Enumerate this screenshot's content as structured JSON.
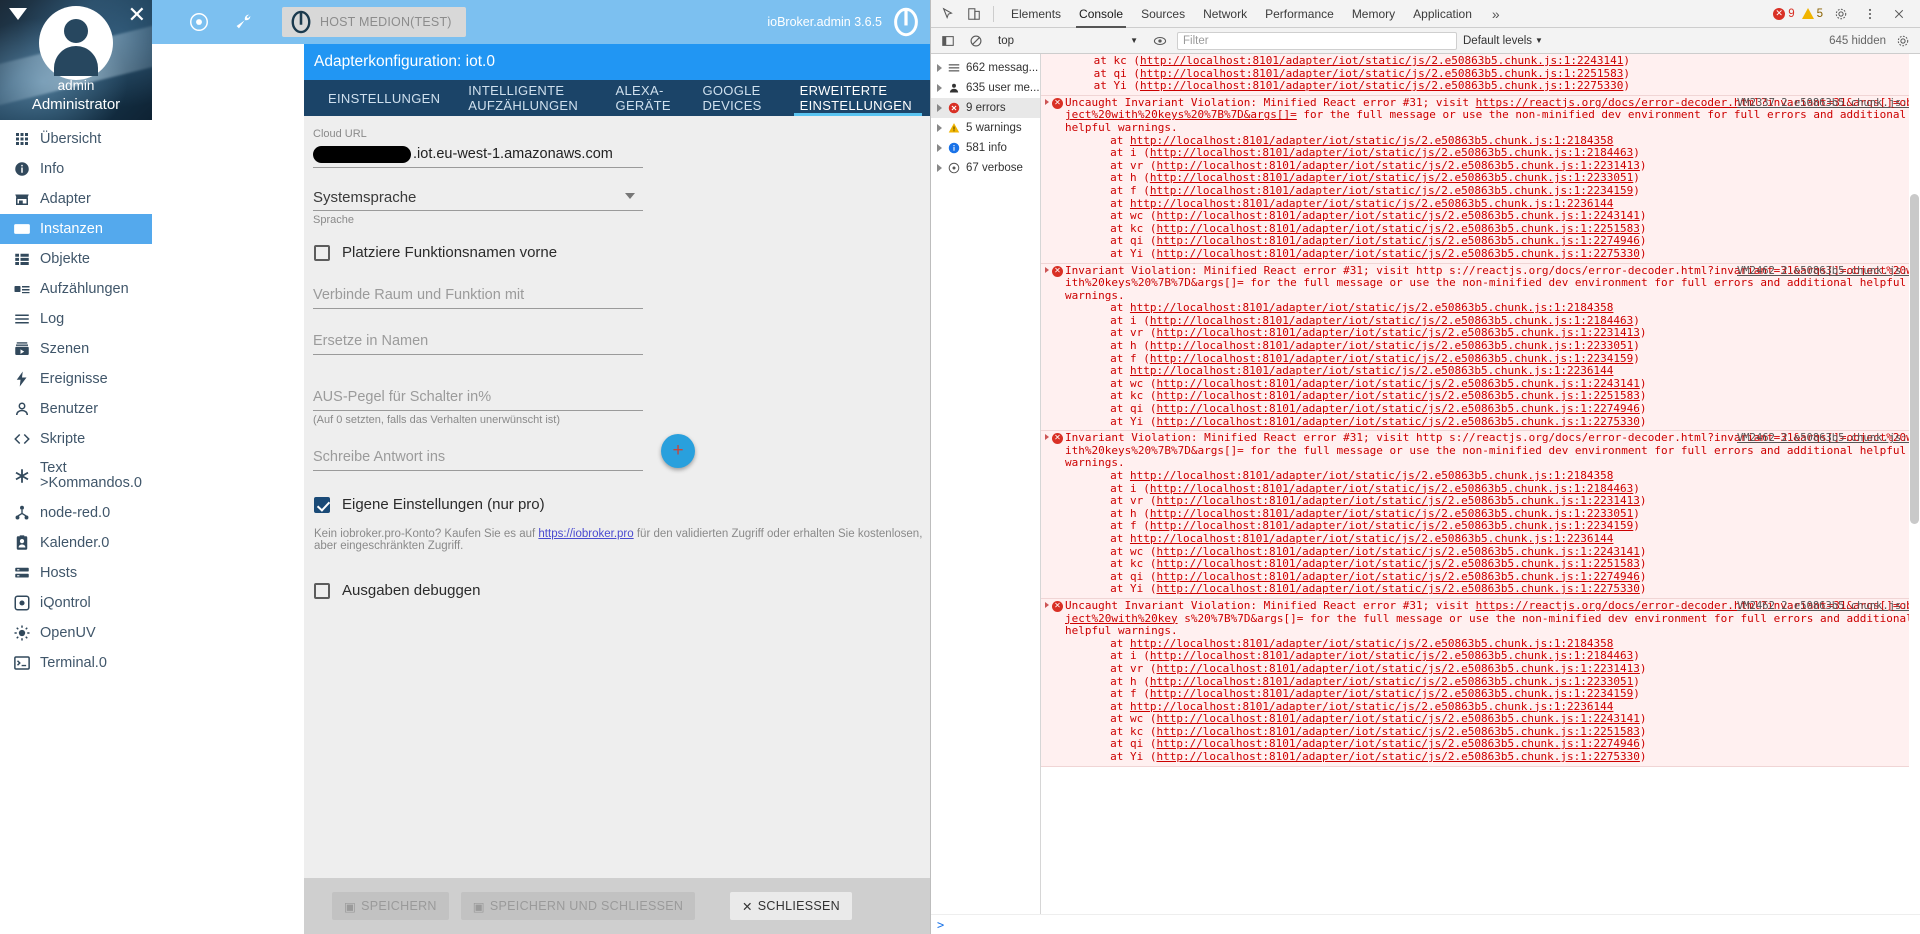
{
  "sidebar": {
    "user": "admin",
    "role": "Administrator",
    "items": [
      {
        "label": "Übersicht",
        "icon": "grid-icon"
      },
      {
        "label": "Info",
        "icon": "info-icon"
      },
      {
        "label": "Adapter",
        "icon": "shop-icon"
      },
      {
        "label": "Instanzen",
        "icon": "instances-icon",
        "active": true
      },
      {
        "label": "Objekte",
        "icon": "list-icon"
      },
      {
        "label": "Aufzählungen",
        "icon": "enums-icon"
      },
      {
        "label": "Log",
        "icon": "lines-icon"
      },
      {
        "label": "Szenen",
        "icon": "scenes-icon"
      },
      {
        "label": "Ereignisse",
        "icon": "bolt-icon"
      },
      {
        "label": "Benutzer",
        "icon": "user-icon"
      },
      {
        "label": "Skripte",
        "icon": "code-icon"
      },
      {
        "label": "Text->Kommandos.0",
        "icon": "asterisk-icon",
        "tall": true
      },
      {
        "label": "node-red.0",
        "icon": "nodered-icon"
      },
      {
        "label": "Kalender.0",
        "icon": "calendar-icon"
      },
      {
        "label": "Hosts",
        "icon": "hosts-icon"
      },
      {
        "label": "iQontrol",
        "icon": "iqontrol-icon"
      },
      {
        "label": "OpenUV",
        "icon": "openuv-icon"
      },
      {
        "label": "Terminal.0",
        "icon": "terminal-icon"
      }
    ]
  },
  "topbar": {
    "eye_icon": "eye-icon",
    "wrench_icon": "wrench-icon",
    "host_chip": "HOST MEDION(TEST)",
    "brand": "ioBroker.admin 3.6.5"
  },
  "dialog": {
    "title": "Adapterkonfiguration: iot.0",
    "tabs": [
      {
        "label": "EINSTELLUNGEN",
        "active": false
      },
      {
        "label": "INTELLIGENTE AUFZÄHLUNGEN",
        "active": false
      },
      {
        "label": "ALEXA-GERÄTE",
        "active": false
      },
      {
        "label": "GOOGLE DEVICES",
        "active": false
      },
      {
        "label": "ERWEITERTE EINSTELLUNGEN",
        "active": true
      }
    ],
    "fields": {
      "cloud_url_label": "Cloud URL",
      "cloud_url_value": ".iot.eu-west-1.amazonaws.com",
      "language_value": "Systemsprache",
      "language_help": "Sprache",
      "function_first_label": "Platziere Funktionsnamen vorne",
      "function_first_checked": false,
      "concat_placeholder": "Verbinde Raum und Funktion mit",
      "replace_placeholder": "Ersetze in Namen",
      "off_level_placeholder": "AUS-Pegel für Schalter in%",
      "off_level_help": "(Auf 0 setzten, falls das Verhalten unerwünscht ist)",
      "response_placeholder": "Schreibe Antwort ins",
      "add_button": "+",
      "own_settings_label": "Eigene Einstellungen (nur pro)",
      "own_settings_checked": true,
      "pro_note_before": "Kein iobroker.pro-Konto? Kaufen Sie es auf ",
      "pro_note_link": "https://iobroker.pro",
      "pro_note_after": " für den validierten Zugriff oder erhalten Sie kostenlosen, aber eingeschränkten Zugriff.",
      "debug_label": "Ausgaben debuggen",
      "debug_checked": false
    },
    "footer": {
      "save": "SPEICHERN",
      "save_close": "SPEICHERN UND SCHLIESSEN",
      "close": "SCHLIESSEN"
    }
  },
  "devtools": {
    "tabs": [
      {
        "label": "Elements",
        "active": false
      },
      {
        "label": "Console",
        "active": true
      },
      {
        "label": "Sources",
        "active": false
      },
      {
        "label": "Network",
        "active": false
      },
      {
        "label": "Performance",
        "active": false
      },
      {
        "label": "Memory",
        "active": false
      },
      {
        "label": "Application",
        "active": false
      }
    ],
    "more": "»",
    "error_count": "9",
    "warning_count": "5",
    "settings_icon": "gear-icon",
    "menu_icon": "kebab-icon",
    "inspect_icon": "inspect-icon",
    "device_icon": "device-toolbar-icon",
    "sidebar_toggle_icon": "console-sidebar-icon",
    "clear_icon": "clear-console-icon",
    "eye_icon": "live-expression-icon",
    "context": "top",
    "filter_placeholder": "Filter",
    "levels": "Default levels",
    "hidden": "645 hidden",
    "groups": [
      {
        "label": "662 messag...",
        "icon": "messages-icon"
      },
      {
        "label": "635 user me...",
        "icon": "user-messages-icon"
      },
      {
        "label": "9 errors",
        "icon": "error-icon",
        "selected": true
      },
      {
        "label": "5 warnings",
        "icon": "warning-icon"
      },
      {
        "label": "581 info",
        "icon": "info-icon"
      },
      {
        "label": "67 verbose",
        "icon": "verbose-icon"
      }
    ],
    "prompt": ">",
    "messages": [
      {
        "type": "tail",
        "lines": [
          "  at kc (http://localhost:8101/adapter/iot/static/js/2.e50863b5.chunk.js:1:2243141)",
          "  at qi (http://localhost:8101/adapter/iot/static/js/2.e50863b5.chunk.js:1:2251583)",
          "  at Yi (http://localhost:8101/adapter/iot/static/js/2.e50863b5.chunk.js:1:2275330)"
        ]
      },
      {
        "type": "error",
        "source": "VM2337 2.e50863b5.chunk.js:1",
        "head": "Uncaught Invariant Violation: Minified React error #31;",
        "body": "visit https://reactjs.org/docs/error-decoder.html?invariant=31&args[]=object%20with%20keys%20%7B%7D&args[]= for the full message or use the non-minified dev environment for full errors and additional helpful warnings.",
        "stack": [
          "at http://localhost:8101/adapter/iot/static/js/2.e50863b5.chunk.js:1:2184358",
          "at i (http://localhost:8101/adapter/iot/static/js/2.e50863b5.chunk.js:1:2184463)",
          "at vr (http://localhost:8101/adapter/iot/static/js/2.e50863b5.chunk.js:1:2231413)",
          "at h (http://localhost:8101/adapter/iot/static/js/2.e50863b5.chunk.js:1:2233051)",
          "at f (http://localhost:8101/adapter/iot/static/js/2.e50863b5.chunk.js:1:2234159)",
          "at http://localhost:8101/adapter/iot/static/js/2.e50863b5.chunk.js:1:2236144",
          "at wc (http://localhost:8101/adapter/iot/static/js/2.e50863b5.chunk.js:1:2243141)",
          "at kc (http://localhost:8101/adapter/iot/static/js/2.e50863b5.chunk.js:1:2251583)",
          "at qi (http://localhost:8101/adapter/iot/static/js/2.e50863b5.chunk.js:1:2274946)",
          "at Yi (http://localhost:8101/adapter/iot/static/js/2.e50863b5.chunk.js:1:2275330)"
        ]
      },
      {
        "type": "error",
        "source": "VM2462 2.e50863b5.chunk.js:1",
        "head": "Invariant Violation: Minified React error #31; visit http",
        "body": "s://reactjs.org/docs/error-decoder.html?invariant=31&args[]=object%20with%20keys%20%7B%7D&args[]= for the full message or use the non-minified dev environment for full errors and additional helpful warnings.",
        "stack": [
          "at http://localhost:8101/adapter/iot/static/js/2.e50863b5.chunk.js:1:2184358",
          "at i (http://localhost:8101/adapter/iot/static/js/2.e50863b5.chunk.js:1:2184463)",
          "at vr (http://localhost:8101/adapter/iot/static/js/2.e50863b5.chunk.js:1:2231413)",
          "at h (http://localhost:8101/adapter/iot/static/js/2.e50863b5.chunk.js:1:2233051)",
          "at f (http://localhost:8101/adapter/iot/static/js/2.e50863b5.chunk.js:1:2234159)",
          "at http://localhost:8101/adapter/iot/static/js/2.e50863b5.chunk.js:1:2236144",
          "at wc (http://localhost:8101/adapter/iot/static/js/2.e50863b5.chunk.js:1:2243141)",
          "at kc (http://localhost:8101/adapter/iot/static/js/2.e50863b5.chunk.js:1:2251583)",
          "at qi (http://localhost:8101/adapter/iot/static/js/2.e50863b5.chunk.js:1:2274946)",
          "at Yi (http://localhost:8101/adapter/iot/static/js/2.e50863b5.chunk.js:1:2275330)"
        ]
      },
      {
        "type": "error",
        "source": "VM2462 2.e50863b5.chunk.js:1",
        "head": "Invariant Violation: Minified React error #31; visit http",
        "body": "s://reactjs.org/docs/error-decoder.html?invariant=31&args[]=object%20with%20keys%20%7B%7D&args[]= for the full message or use the non-minified dev environment for full errors and additional helpful warnings.",
        "stack": [
          "at http://localhost:8101/adapter/iot/static/js/2.e50863b5.chunk.js:1:2184358",
          "at i (http://localhost:8101/adapter/iot/static/js/2.e50863b5.chunk.js:1:2184463)",
          "at vr (http://localhost:8101/adapter/iot/static/js/2.e50863b5.chunk.js:1:2231413)",
          "at h (http://localhost:8101/adapter/iot/static/js/2.e50863b5.chunk.js:1:2233051)",
          "at f (http://localhost:8101/adapter/iot/static/js/2.e50863b5.chunk.js:1:2234159)",
          "at http://localhost:8101/adapter/iot/static/js/2.e50863b5.chunk.js:1:2236144",
          "at wc (http://localhost:8101/adapter/iot/static/js/2.e50863b5.chunk.js:1:2243141)",
          "at kc (http://localhost:8101/adapter/iot/static/js/2.e50863b5.chunk.js:1:2251583)",
          "at qi (http://localhost:8101/adapter/iot/static/js/2.e50863b5.chunk.js:1:2274946)",
          "at Yi (http://localhost:8101/adapter/iot/static/js/2.e50863b5.chunk.js:1:2275330)"
        ]
      },
      {
        "type": "error",
        "source": "VM2462 2.e50863b5.chunk.js:1",
        "head": "Uncaught Invariant Violation: Minified React error #31;",
        "body": "visit https://reactjs.org/docs/error-decoder.html?invariant=31&args[]=object%20with%20key s%20%7B%7D&args[]= for the full message or use the non-minified dev environment for full errors and additional helpful warnings.",
        "stack": [
          "at http://localhost:8101/adapter/iot/static/js/2.e50863b5.chunk.js:1:2184358",
          "at i (http://localhost:8101/adapter/iot/static/js/2.e50863b5.chunk.js:1:2184463)",
          "at vr (http://localhost:8101/adapter/iot/static/js/2.e50863b5.chunk.js:1:2231413)",
          "at h (http://localhost:8101/adapter/iot/static/js/2.e50863b5.chunk.js:1:2233051)",
          "at f (http://localhost:8101/adapter/iot/static/js/2.e50863b5.chunk.js:1:2234159)",
          "at http://localhost:8101/adapter/iot/static/js/2.e50863b5.chunk.js:1:2236144",
          "at wc (http://localhost:8101/adapter/iot/static/js/2.e50863b5.chunk.js:1:2243141)",
          "at kc (http://localhost:8101/adapter/iot/static/js/2.e50863b5.chunk.js:1:2251583)",
          "at qi (http://localhost:8101/adapter/iot/static/js/2.e50863b5.chunk.js:1:2274946)",
          "at Yi (http://localhost:8101/adapter/iot/static/js/2.e50863b5.chunk.js:1:2275330)"
        ]
      }
    ]
  }
}
